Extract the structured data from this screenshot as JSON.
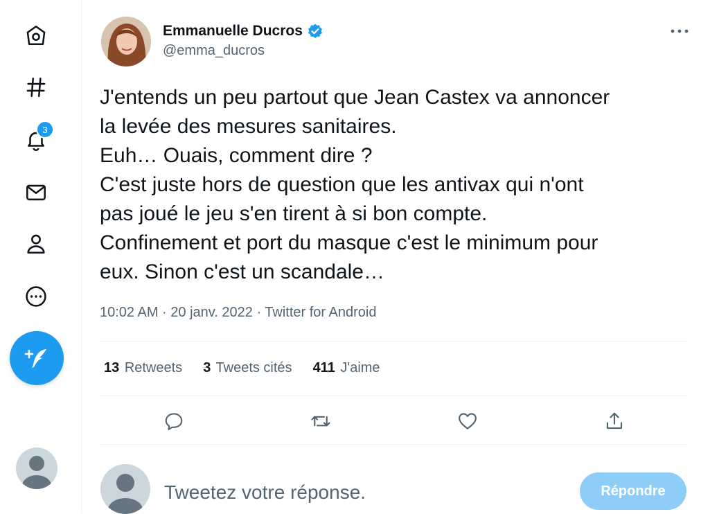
{
  "sidebar": {
    "notifications_badge": "3"
  },
  "tweet": {
    "author_name": "Emmanuelle Ducros",
    "author_handle": "@emma_ducros",
    "lines": [
      "J'entends un peu partout que Jean Castex va annoncer",
      "la levée des mesures sanitaires.",
      "Euh… Ouais, comment dire ?",
      "C'est juste hors de question que les antivax qui n'ont",
      "pas joué le jeu s'en tirent à si bon compte.",
      "Confinement et port du masque c'est le minimum pour",
      "eux. Sinon c'est un scandale…"
    ],
    "meta": "10:02 AM · 20 janv. 2022 · Twitter for Android",
    "stats": {
      "retweets_count": "13",
      "retweets_label": "Retweets",
      "quotes_count": "3",
      "quotes_label": "Tweets cités",
      "likes_count": "411",
      "likes_label": "J'aime"
    }
  },
  "reply": {
    "placeholder": "Tweetez votre réponse.",
    "button_label": "Répondre"
  },
  "colors": {
    "accent": "#1d9bf0",
    "verified": "#1d9bf0",
    "reply_button_disabled": "#8ecdf7",
    "secondary_text": "#536471"
  }
}
